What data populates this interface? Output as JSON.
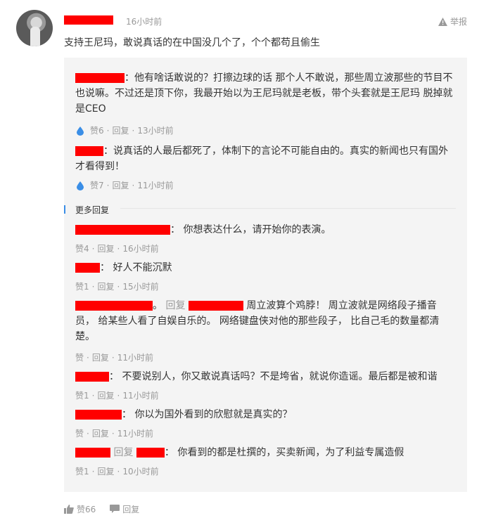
{
  "header": {
    "time": "16小时前",
    "report_label": "举报"
  },
  "comment": {
    "text": "支持王尼玛，敢说真话的在中国没几个了，个个都苟且偷生"
  },
  "top_replies": [
    {
      "text_line1": "他有啥话敢说的？打擦边球的话 那个人不敢说，那些周立波那些的节目不",
      "text_line2": "也说嘛。不过还是顶下你，我最开始以为王尼玛就是老板，带个头套就是王尼玛 脱掉就",
      "text_line3": "是CEO",
      "likes": "赞6",
      "reply": "回复",
      "time": "13小时前"
    },
    {
      "text_line1": "说真话的人最后都死了，体制下的言论不可能自由的。真实的新闻也只有国外",
      "text_line2": "才看得到！",
      "likes": "赞7",
      "reply": "回复",
      "time": "11小时前"
    }
  ],
  "more_replies_label": "更多回复",
  "more_replies": [
    {
      "text": "你想表达什么，请开始你的表演。",
      "likes": "赞4",
      "reply": "回复",
      "time": "16小时前"
    },
    {
      "text": "好人不能沉默",
      "likes": "赞1",
      "reply": "回复",
      "time": "15小时前"
    },
    {
      "reply_word": "回复",
      "text_line1": "周立波算个鸡脖！ 周立波就是网络段子播音",
      "text_line2": "员， 给某些人看了自娱自乐的。 网络键盘侠对他的那些段子， 比自己毛的数量都清",
      "text_line3": "楚。",
      "likes": "赞",
      "reply": "回复",
      "time": "11小时前"
    },
    {
      "text": "不要说别人，你又敢说真话吗？不是垮省，就说你造谣。最后都是被和谐",
      "likes": "赞1",
      "reply": "回复",
      "time": "11小时前"
    },
    {
      "text": "你以为国外看到的欣慰就是真实的？",
      "likes": "赞",
      "reply": "回复",
      "time": "11小时前"
    },
    {
      "reply_word": "回复",
      "text": "你看到的都是杜撰的，买卖新闻，为了利益专属造假",
      "likes": "赞1",
      "reply": "回复",
      "time": "10小时前"
    }
  ],
  "footer": {
    "likes": "赞66",
    "reply": "回复"
  },
  "colors": {
    "redaction": "#ff0000",
    "accent": "#3a8ee6",
    "meta_gray": "#999999"
  }
}
